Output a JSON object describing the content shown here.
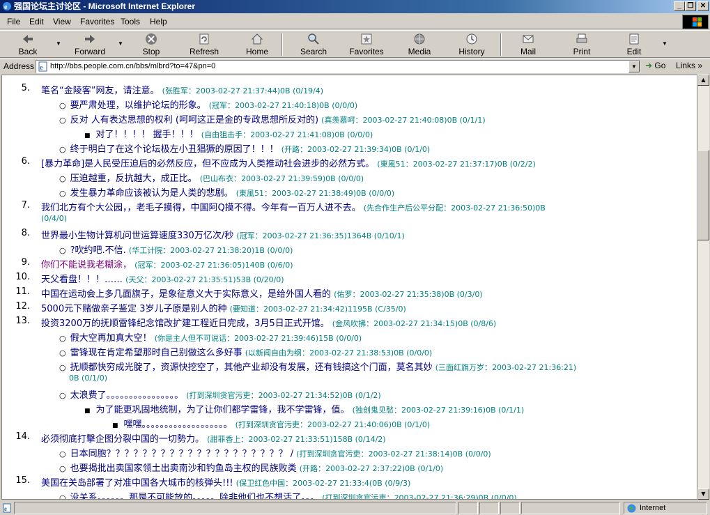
{
  "window": {
    "title": "强国论坛主讨论区 - Microsoft Internet Explorer",
    "minimize_glyph": "_",
    "maximize_glyph": "❐",
    "close_glyph": "✕"
  },
  "menu": [
    "File",
    "Edit",
    "View",
    "Favorites",
    "Tools",
    "Help"
  ],
  "toolbar": {
    "back": "Back",
    "forward": "Forward",
    "stop": "Stop",
    "refresh": "Refresh",
    "home": "Home",
    "search": "Search",
    "favorites": "Favorites",
    "media": "Media",
    "history": "History",
    "mail": "Mail",
    "print": "Print",
    "edit": "Edit",
    "dropdown_glyph": "▼"
  },
  "address": {
    "label": "Address",
    "url": "http://bbs.people.com.cn/bbs/mlbrd?to=47&pn=0",
    "go": "Go",
    "links": "Links",
    "links_glyph": "»",
    "go_glyph": "➜"
  },
  "posts": {
    "p5": {
      "num": "5.",
      "title": "笔名“金陵客”网友，请注意。",
      "meta": "(张胜军：",
      "dt": "2003-02-27 21:37:44)0B (0/19/4)"
    },
    "r5a": {
      "title": "要严肃处理，以维护论坛的形象。",
      "meta": "(冠军：",
      "dt": "2003-02-27 21:40:18)0B (0/0/0)"
    },
    "r5b": {
      "title": "反对 人有表达思想的权利 (呵呵这正是金的专政思想所反对的)",
      "meta": "(真羡慕呵：",
      "dt": "2003-02-27 21:40:08)0B (0/1/1)"
    },
    "r5b1": {
      "title": "对了！！！！ 握手！！！",
      "meta": "(自由狙击手：",
      "dt": "2003-02-27 21:41:08)0B (0/0/0)"
    },
    "r5c": {
      "title": "终于明白了在这个论坛极左小丑猖獗的原因了！！！",
      "meta": "(开路：",
      "dt": "2003-02-27 21:39:34)0B (0/1/0)"
    },
    "p6": {
      "num": "6.",
      "title": "[暴力革命]是人民受压迫后的必然反应，但不应成为人类推动社会进步的必然方式。",
      "meta": "(東風51：",
      "dt": "2003-02-27 21:37:17)0B (0/2/2)"
    },
    "r6a": {
      "title": "压迫越重，反抗越大，成正比。",
      "meta": "(巴山布衣：",
      "dt": "2003-02-27 21:39:59)0B (0/0/0)"
    },
    "r6b": {
      "title": "发生暴力革命应该被认为是人类的悲剧。",
      "meta": "(東風51：",
      "dt": "2003-02-27 21:38:49)0B (0/0/0)"
    },
    "p7": {
      "num": "7.",
      "title": "我们北方有个大公园，，老毛子摸得，中国阿Q摸不得。今年有一百万人进不去。",
      "meta": "(先合作生产后公平分配：",
      "dt": "2003-02-27 21:36:50)0B",
      "dt2": "(0/4/0)"
    },
    "p8": {
      "num": "8.",
      "title": "世界最小生物计算机问世运算速度330万亿次/秒",
      "meta": "(冠军：",
      "dt": "2003-02-27 21:36:35)1364B (0/10/1)"
    },
    "r8a": {
      "title": "?吹约吧.不信.",
      "meta": "(华工计院：",
      "dt": "2003-02-27 21:38:20)1B (0/0/0)"
    },
    "p9": {
      "num": "9.",
      "title": "你们不能说我老糊涂，",
      "meta": "(冠军：",
      "dt": "2003-02-27 21:36:05)140B (0/6/0)"
    },
    "p10": {
      "num": "10.",
      "title": "天父看盘！！！……",
      "meta": "(天父：",
      "dt": "2003-02-27 21:35:51)53B (0/20/0)"
    },
    "p11": {
      "num": "11.",
      "title": "中国在运动会上多几面旗子，是象征意义大于实际意义，是给外国人看的",
      "meta": "(佑罗：",
      "dt": "2003-02-27 21:35:38)0B (0/3/0)"
    },
    "p12": {
      "num": "12.",
      "title": "5000元下赌做亲子鉴定 3岁儿子原是别人的种",
      "meta": "(要知道：",
      "dt": "2003-02-27 21:34:42)1195B (C/35/0)"
    },
    "p13": {
      "num": "13.",
      "title": "投资3200万的抚顺雷锋纪念馆改扩建工程近日完成，3月5日正式开馆。",
      "meta": "(金风吹拂：",
      "dt": "2003-02-27 21:34:15)0B (0/8/6)"
    },
    "r13a": {
      "title": "假大空再加真大空！",
      "meta": "(你是主人但不可说话：",
      "dt": "2003-02-27 21:39:46)15B (0/0/0)"
    },
    "r13b": {
      "title": "雷锋现在肯定希望那时自己别做这么多好事",
      "meta": "(以新闻自由为纲：",
      "dt": "2003-02-27 21:38:53)0B (0/0/0)"
    },
    "r13c": {
      "title": "抚顺都快穷成光腚了，资源快挖空了，其他产业却没有发展，还有钱搞这个门面，莫名其妙",
      "meta": "(三面红旗万岁：",
      "dt": "2003-02-27 21:36:21)",
      "dt2": "0B (0/1/0)"
    },
    "r13d": {
      "title": "太浪费了。。。。。。。。。。。。。。。。",
      "meta": "(打到深圳贪官污吏：",
      "dt": "2003-02-27 21:34:52)0B (0/1/2)"
    },
    "r13d1": {
      "title": "为了能更巩固地统制，为了让你们都学雷锋，我不学雷锋，值。",
      "meta": "(独创鬼见愁：",
      "dt": "2003-02-27 21:39:16)0B (0/1/1)"
    },
    "r13d2": {
      "title": "嘿嘿。。。。。。。。。。。。。。。。。。。",
      "meta": "(打到深圳贪官污吏：",
      "dt": "2003-02-27 21:40:06)0B (0/1/0)"
    },
    "p14": {
      "num": "14.",
      "title": "必须彻底打擊企图分裂中国的一切勢力。",
      "meta": "(甜菲香上：",
      "dt": "2003-02-27 21:33:51)158B (0/14/2)"
    },
    "r14a": {
      "title": "日本同胞？？？？？？？？？？？？？？？？？？？？ /",
      "meta": "(打到深圳贪官污吏：",
      "dt": "2003-02-27 21:38:14)0B (0/0/0)"
    },
    "r14b": {
      "title": "也要揭批出卖国家领土出卖南沙和钓鱼岛主权的民族败类",
      "meta": "(开路：",
      "dt": "2003-02-27 2:37:22)0B (0/1/0)"
    },
    "p15": {
      "num": "15.",
      "title": "美国在关岛部署了对准中国各大城市的核弹头!!!",
      "meta": "(保卫红色中国：",
      "dt": "2003-02-27 21:33:4(0B (0/9/3)"
    },
    "r15a": {
      "title": "没关系。。。。。。那是不可能放的。。。。。除非他们也不想活了。。。",
      "meta": "(打到深圳贪官污吏：",
      "dt": "2003-02-27 21:36:29)0B (0/0/0)"
    }
  },
  "status": {
    "zone": "Internet"
  },
  "colors": {
    "link": "#000080",
    "visited": "#800080",
    "meta": "#008080",
    "title_bar": "#0a246a"
  }
}
